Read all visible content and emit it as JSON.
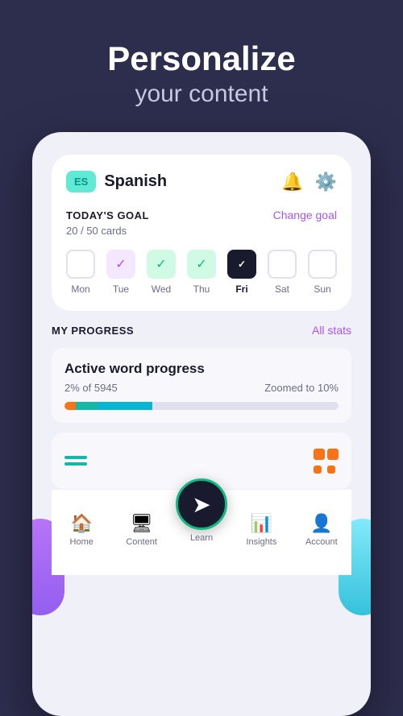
{
  "header": {
    "line1": "Personalize",
    "line2": "your content"
  },
  "app": {
    "language": {
      "badge": "ES",
      "name": "Spanish"
    },
    "goal": {
      "title": "TODAY'S GOAL",
      "count": "20 / 50 cards",
      "change_label": "Change goal"
    },
    "days": [
      {
        "label": "Mon",
        "state": "empty"
      },
      {
        "label": "Tue",
        "state": "purple"
      },
      {
        "label": "Wed",
        "state": "green"
      },
      {
        "label": "Thu",
        "state": "green"
      },
      {
        "label": "Fri",
        "state": "today"
      },
      {
        "label": "Sat",
        "state": "none"
      },
      {
        "label": "Sun",
        "state": "none"
      }
    ],
    "progress": {
      "title": "MY PROGRESS",
      "all_stats": "All stats",
      "word_card": {
        "title": "Active word progress",
        "percent": "2% of 5945",
        "zoom": "Zoomed to 10%"
      }
    }
  },
  "nav": {
    "items": [
      {
        "label": "Home",
        "active": false
      },
      {
        "label": "Content",
        "active": false
      },
      {
        "label": "Learn",
        "active": true
      },
      {
        "label": "Insights",
        "active": false
      },
      {
        "label": "Account",
        "active": false
      }
    ]
  }
}
